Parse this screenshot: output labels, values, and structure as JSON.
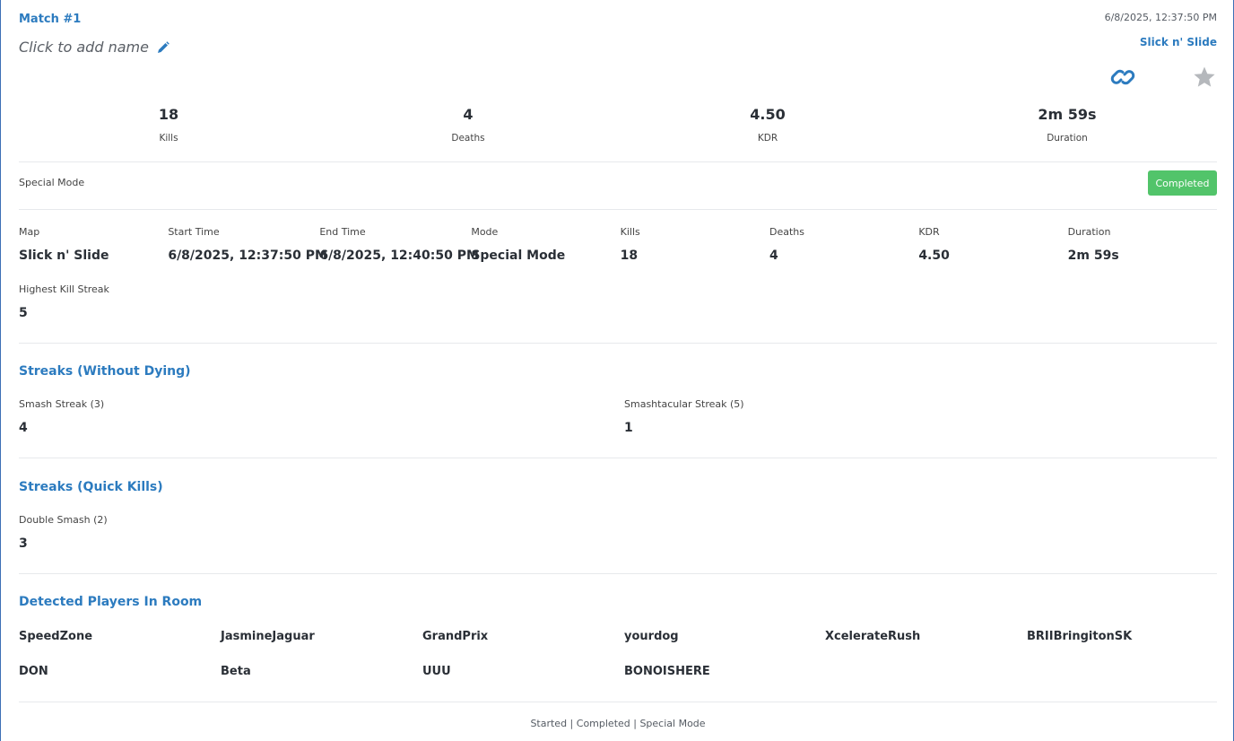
{
  "match": {
    "title": "Match #1",
    "name_placeholder": "Click to add name",
    "timestamp": "6/8/2025, 12:37:50 PM",
    "map_link": "Slick n' Slide"
  },
  "summary": {
    "kills": {
      "value": "18",
      "label": "Kills"
    },
    "deaths": {
      "value": "4",
      "label": "Deaths"
    },
    "kdr": {
      "value": "4.50",
      "label": "KDR"
    },
    "duration": {
      "value": "2m 59s",
      "label": "Duration"
    }
  },
  "mode_row": {
    "mode": "Special Mode",
    "status": "Completed",
    "status_color": "#52c46a"
  },
  "details": {
    "map": {
      "label": "Map",
      "value": "Slick n' Slide"
    },
    "start": {
      "label": "Start Time",
      "value": "6/8/2025, 12:37:50 PM"
    },
    "end": {
      "label": "End Time",
      "value": "6/8/2025, 12:40:50 PM"
    },
    "mode": {
      "label": "Mode",
      "value": "Special Mode"
    },
    "kills": {
      "label": "Kills",
      "value": "18"
    },
    "deaths": {
      "label": "Deaths",
      "value": "4"
    },
    "kdr": {
      "label": "KDR",
      "value": "4.50"
    },
    "duration": {
      "label": "Duration",
      "value": "2m 59s"
    },
    "highest_streak": {
      "label": "Highest Kill Streak",
      "value": "5"
    }
  },
  "streaks_without_dying": {
    "title": "Streaks (Without Dying)",
    "items": [
      {
        "label": "Smash Streak (3)",
        "value": "4"
      },
      {
        "label": "Smashtacular Streak (5)",
        "value": "1"
      }
    ]
  },
  "streaks_quick_kills": {
    "title": "Streaks (Quick Kills)",
    "items": [
      {
        "label": "Double Smash (2)",
        "value": "3"
      }
    ]
  },
  "players": {
    "title": "Detected Players In Room",
    "names": [
      "SpeedZone",
      "JasmineJaguar",
      "GrandPrix",
      "yourdog",
      "XcelerateRush",
      "BRIIBringitonSK",
      "DON",
      "Beta",
      "UUU",
      "BONOISHERE"
    ]
  },
  "footer": "Started | Completed | Special Mode",
  "colors": {
    "accent": "#2c7bbf",
    "success": "#52c46a",
    "frame": "#3d6fb6"
  },
  "icons": {
    "edit": "pencil-icon",
    "link": "link-icon",
    "favorite": "star-icon"
  }
}
